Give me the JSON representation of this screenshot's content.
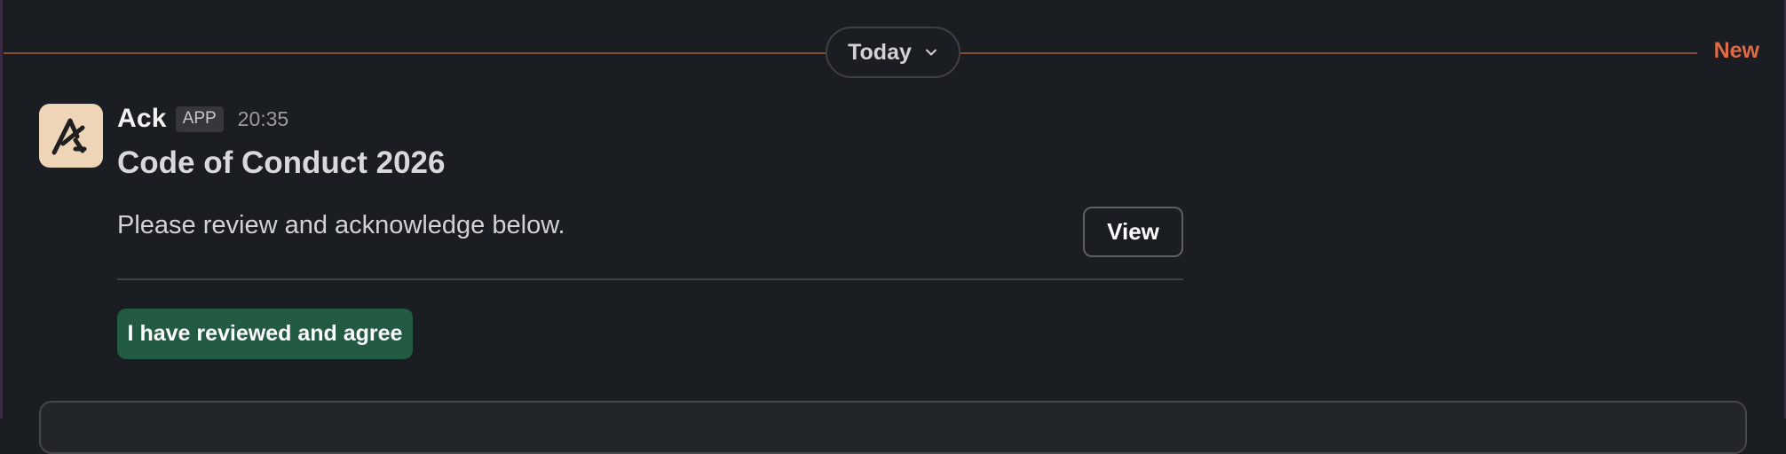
{
  "divider": {
    "date_label": "Today",
    "new_label": "New",
    "new_color": "#de6a46"
  },
  "message": {
    "sender": "Ack",
    "badge": "APP",
    "timestamp": "20:35",
    "avatar_icon": "ack-logo-icon",
    "title": "Code of Conduct 2026",
    "body": "Please review and acknowledge below.",
    "view_button_label": "View",
    "agree_button_label": "I have reviewed and agree",
    "agree_button_color": "#235a42"
  }
}
